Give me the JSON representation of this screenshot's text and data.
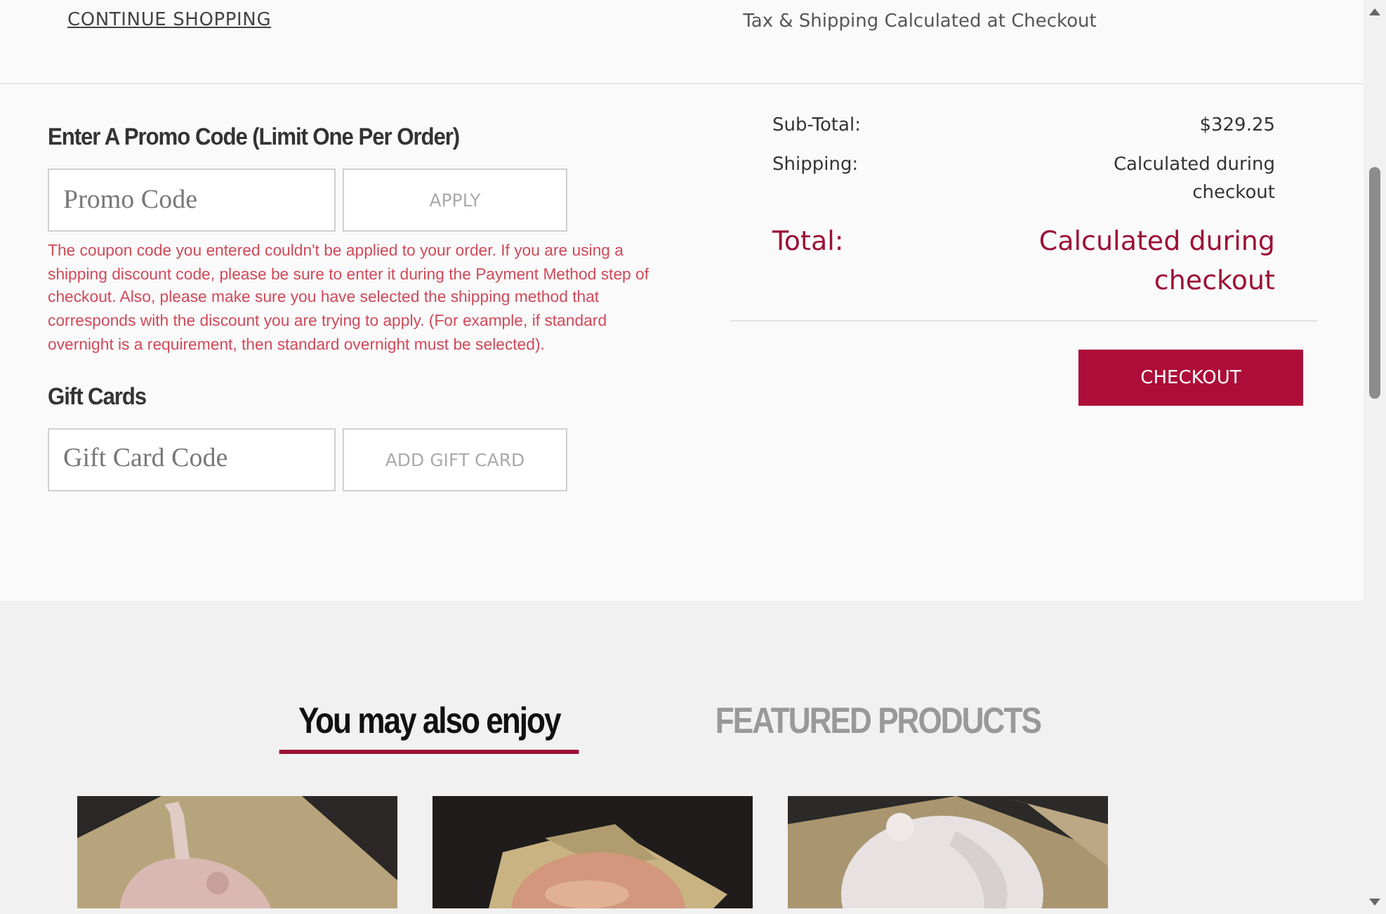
{
  "header": {
    "continue_link": "CONTINUE SHOPPING",
    "tax_note": "Tax & Shipping Calculated at Checkout"
  },
  "promo": {
    "heading": "Enter A Promo Code (Limit One Per Order)",
    "placeholder": "Promo Code",
    "button": "APPLY",
    "error": "The coupon code you entered couldn't be applied to your order. If you are using a shipping discount code, please be sure to enter it during the Payment Method step of checkout. Also, please make sure you have selected the shipping method that corresponds with the discount you are trying to apply. (For example, if standard overnight is a requirement, then standard overnight must be selected)."
  },
  "gift_cards": {
    "heading": "Gift Cards",
    "placeholder": "Gift Card Code",
    "button": "ADD GIFT CARD"
  },
  "summary": {
    "rows": [
      {
        "kind": "plain",
        "label": "Sub-Total:",
        "value": "$329.25"
      },
      {
        "kind": "plain",
        "label": "Shipping:",
        "value": "Calculated during checkout"
      },
      {
        "kind": "total",
        "label": "Total:",
        "value": "Calculated during checkout"
      }
    ],
    "checkout_button": "CHECKOUT"
  },
  "tabs": [
    {
      "label": "You may also enjoy",
      "selected": true
    },
    {
      "label": "FEATURED PRODUCTS",
      "selected": false
    }
  ]
}
